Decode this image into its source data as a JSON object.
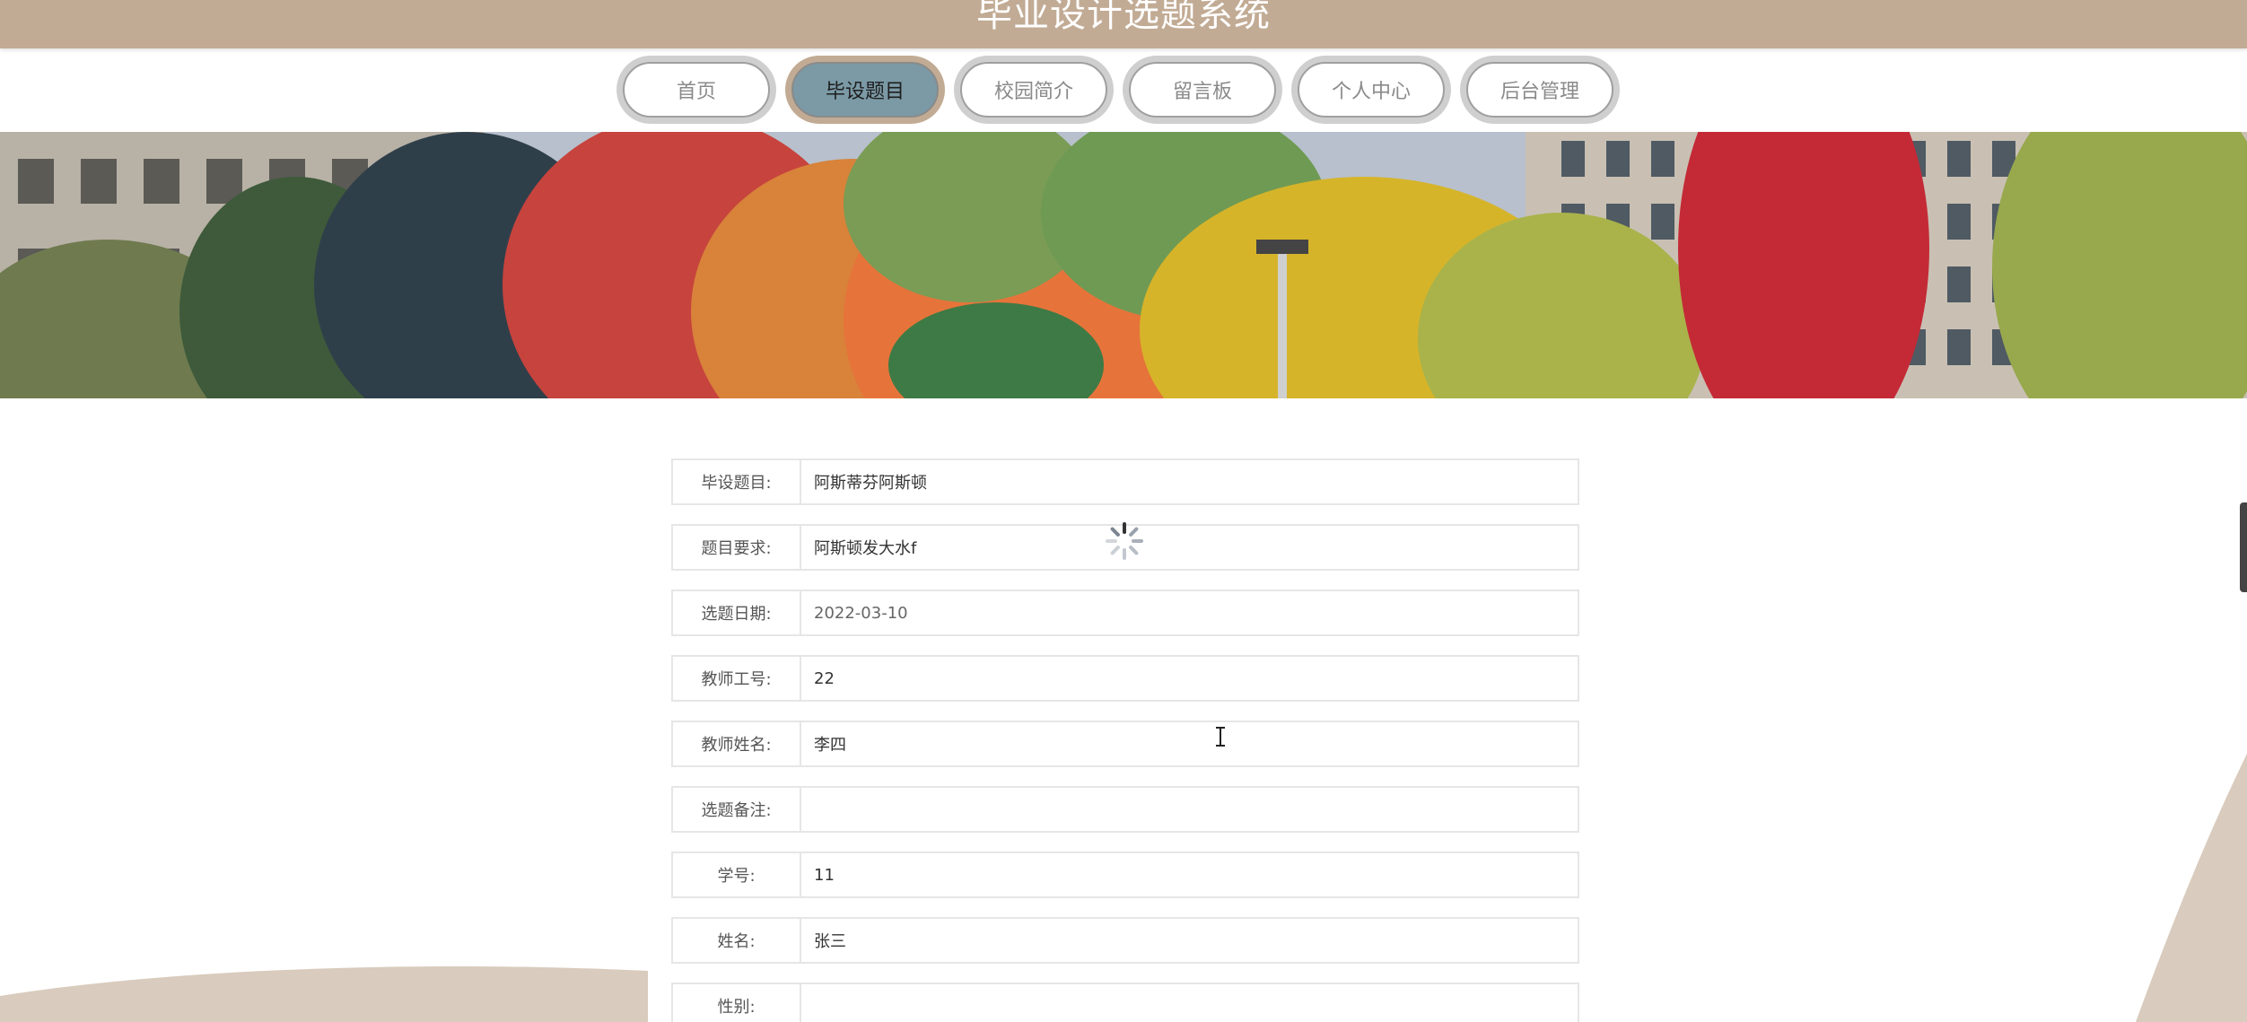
{
  "header": {
    "site_title": "毕业设计选题系统"
  },
  "nav": {
    "items": [
      {
        "label": "首页"
      },
      {
        "label": "毕设题目"
      },
      {
        "label": "校园简介"
      },
      {
        "label": "留言板"
      },
      {
        "label": "个人中心"
      },
      {
        "label": "后台管理"
      }
    ],
    "active_index": 1
  },
  "form": {
    "fields": [
      {
        "label": "毕设题目:",
        "value": "阿斯蒂芬阿斯顿"
      },
      {
        "label": "题目要求:",
        "value": "阿斯顿发大水f"
      },
      {
        "label": "选题日期:",
        "value": "2022-03-10"
      },
      {
        "label": "教师工号:",
        "value": "22"
      },
      {
        "label": "教师姓名:",
        "value": "李四"
      },
      {
        "label": "选题备注:",
        "value": ""
      },
      {
        "label": "学号:",
        "value": "11"
      },
      {
        "label": "姓名:",
        "value": "张三"
      },
      {
        "label": "性别:",
        "value": ""
      }
    ]
  },
  "colors": {
    "header_bg": "#c2ab94",
    "nav_active_bg": "#7b9aa6",
    "nav_ring": "#cfcfcf",
    "deco_curve": "#d9cbbd"
  },
  "icons": {
    "loading": "loading-spinner-icon",
    "cursor": "text-cursor-icon"
  }
}
